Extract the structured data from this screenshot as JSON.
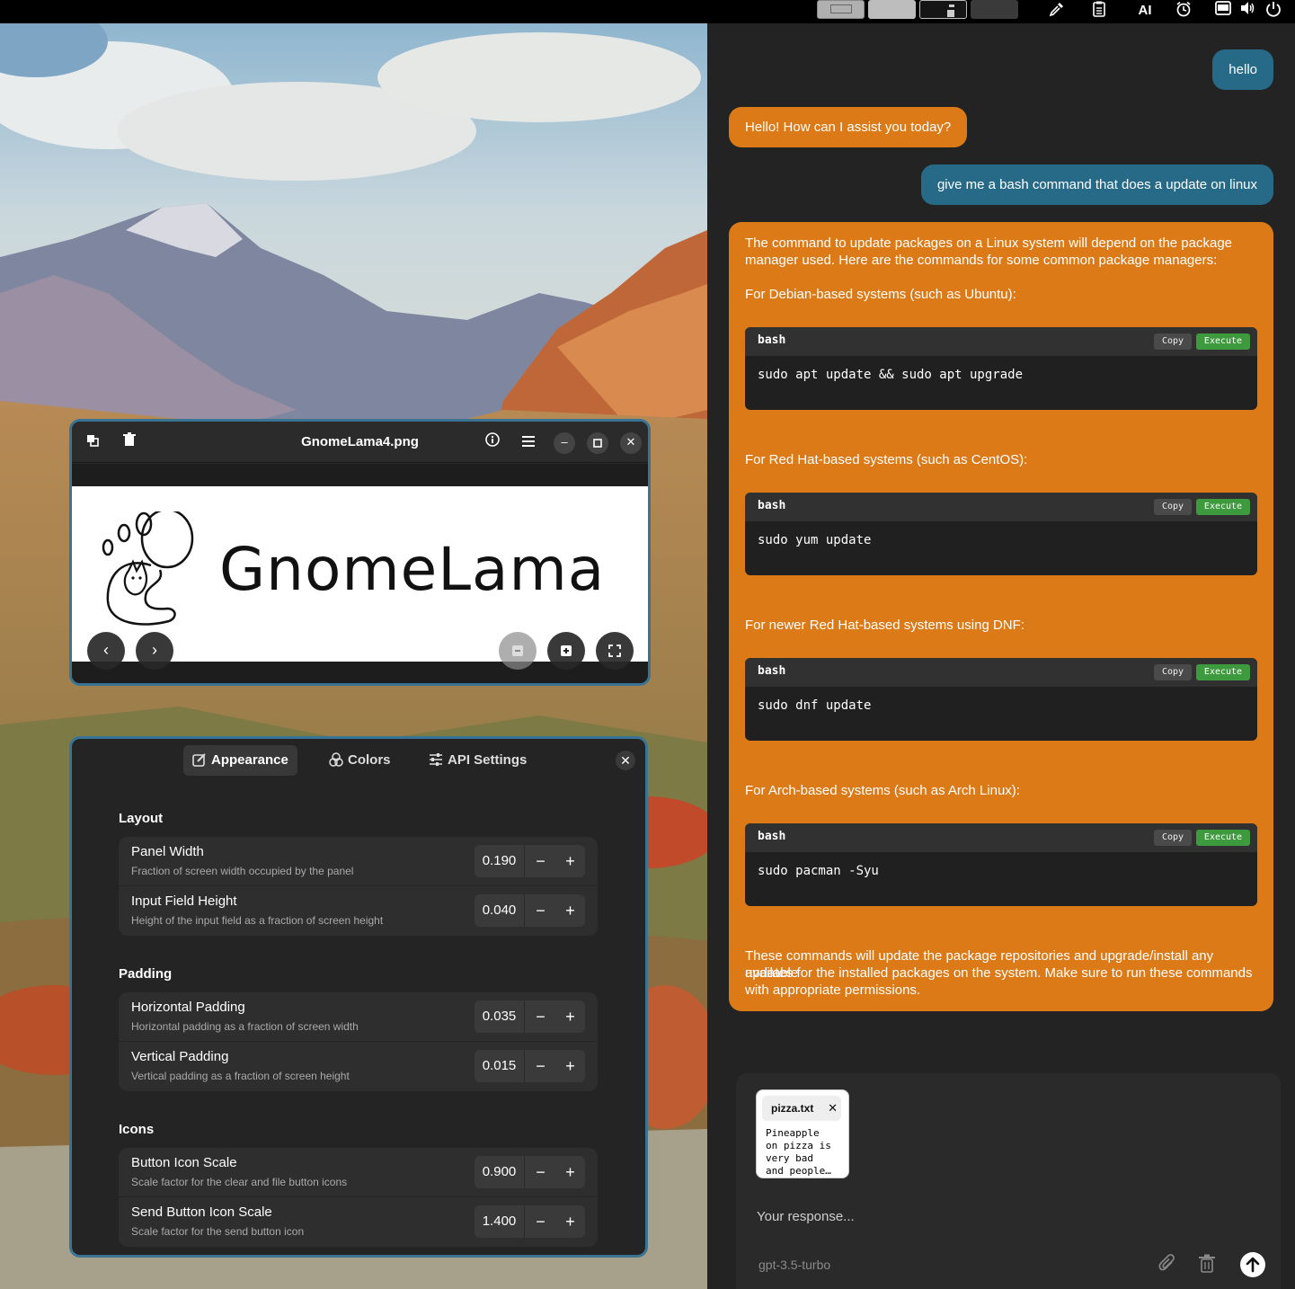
{
  "topbar": {
    "workspaces": [
      "workspace-1",
      "workspace-2",
      "workspace-3",
      "workspace-4"
    ],
    "ai_label": "AI",
    "icons": [
      "color-picker-icon",
      "clipboard-icon",
      "alarm-icon",
      "screen-icon",
      "volume-icon",
      "power-icon"
    ]
  },
  "viewer": {
    "title": "GnomeLama4.png",
    "logo_text": "GnomeLama"
  },
  "prefs": {
    "tabs": [
      {
        "label": "Appearance",
        "icon": "appearance-icon",
        "active": true
      },
      {
        "label": "Colors",
        "icon": "palette-icon"
      },
      {
        "label": "API Settings",
        "icon": "sliders-icon"
      }
    ],
    "sections": [
      {
        "title": "Layout",
        "rows": [
          {
            "title": "Panel Width",
            "subtitle": "Fraction of screen width occupied by the panel",
            "value": "0.190"
          },
          {
            "title": "Input Field Height",
            "subtitle": "Height of the input field as a fraction of screen height",
            "value": "0.040"
          }
        ]
      },
      {
        "title": "Padding",
        "rows": [
          {
            "title": "Horizontal Padding",
            "subtitle": "Horizontal padding as a fraction of screen width",
            "value": "0.035"
          },
          {
            "title": "Vertical Padding",
            "subtitle": "Vertical padding as a fraction of screen height",
            "value": "0.015"
          }
        ]
      },
      {
        "title": "Icons",
        "rows": [
          {
            "title": "Button Icon Scale",
            "subtitle": "Scale factor for the clear and file button icons",
            "value": "0.900"
          },
          {
            "title": "Send Button Icon Scale",
            "subtitle": "Scale factor for the send button icon",
            "value": "1.400"
          }
        ]
      }
    ],
    "minus": "−",
    "plus": "+"
  },
  "chat": {
    "user1": "hello",
    "assistant1": "Hello! How can I assist you today?",
    "user2": "give me a bash command that does a update on linux",
    "assistant2": {
      "intro_1": "The command to update packages on a Linux system will depend on the package",
      "intro_2": "manager used. Here are the commands for some common package managers:",
      "sections": [
        {
          "heading": "For Debian-based systems (such as Ubuntu):",
          "lang": "bash",
          "command": "sudo apt update && sudo apt upgrade"
        },
        {
          "heading": "For Red Hat-based systems (such as CentOS):",
          "lang": "bash",
          "command": "sudo yum update"
        },
        {
          "heading": "For newer Red Hat-based systems using DNF:",
          "lang": "bash",
          "command": "sudo dnf update"
        },
        {
          "heading": "For Arch-based systems (such as Arch Linux):",
          "lang": "bash",
          "command": "sudo pacman -Syu"
        }
      ],
      "outro_1": "These commands will update the package repositories and upgrade/install any available",
      "outro_2": "updates for the installed packages on the system. Make sure to run these commands",
      "outro_3": "with appropriate permissions.",
      "copy_label": "Copy",
      "execute_label": "Execute"
    },
    "attachment": {
      "filename": "pizza.txt",
      "preview": "Pineapple\non pizza is\nvery bad\nand people…"
    },
    "input_placeholder": "Your response...",
    "model": "gpt-3.5-turbo",
    "colors": {
      "user": "#266a87",
      "assistant": "#dd7a18",
      "execute": "#3d9a3d"
    }
  }
}
